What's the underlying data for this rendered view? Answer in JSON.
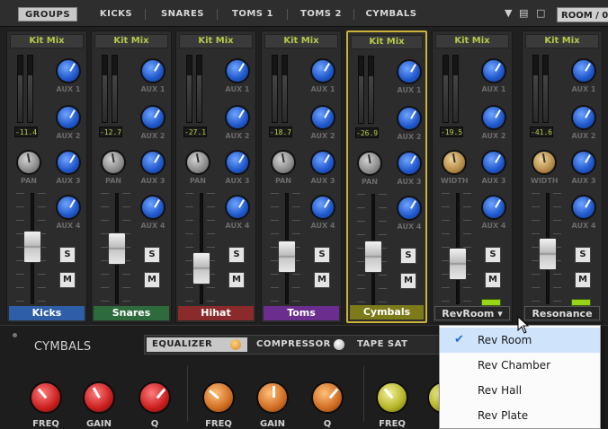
{
  "tabs": [
    {
      "label": "GROUPS",
      "active": true
    },
    {
      "label": "KICKS",
      "active": false
    },
    {
      "label": "SNARES",
      "active": false
    },
    {
      "label": "TOMS 1",
      "active": false
    },
    {
      "label": "TOMS 2",
      "active": false
    },
    {
      "label": "CYMBALS",
      "active": false
    }
  ],
  "toolbar": {
    "menu_icon": "dropdown-arrow-icon",
    "save_icon": "save-icon",
    "delete_icon": "trash-icon",
    "room_label": "ROOM / 0"
  },
  "channels": [
    {
      "kitmix": "Kit Mix",
      "peak": "-11.4",
      "aux": [
        "AUX 1",
        "AUX 2",
        "AUX 3",
        "AUX 4"
      ],
      "pan_label": "PAN",
      "name": "Kicks",
      "name_color": "#2f5ea8",
      "fader": 0.62,
      "solo": "S",
      "mute": "M"
    },
    {
      "kitmix": "Kit Mix",
      "peak": "-12.7",
      "aux": [
        "AUX 1",
        "AUX 2",
        "AUX 3",
        "AUX 4"
      ],
      "pan_label": "PAN",
      "name": "Snares",
      "name_color": "#2d6b3d",
      "fader": 0.6,
      "solo": "S",
      "mute": "M"
    },
    {
      "kitmix": "Kit Mix",
      "peak": "-27.1",
      "aux": [
        "AUX 1",
        "AUX 2",
        "AUX 3",
        "AUX 4"
      ],
      "pan_label": "PAN",
      "name": "Hihat",
      "name_color": "#8a2a2a",
      "fader": 0.4,
      "solo": "S",
      "mute": "M"
    },
    {
      "kitmix": "Kit Mix",
      "peak": "-18.7",
      "aux": [
        "AUX 1",
        "AUX 2",
        "AUX 3",
        "AUX 4"
      ],
      "pan_label": "PAN",
      "name": "Toms",
      "name_color": "#6b2d8e",
      "fader": 0.52,
      "solo": "S",
      "mute": "M"
    },
    {
      "kitmix": "Kit Mix",
      "peak": "-26.9",
      "aux": [
        "AUX 1",
        "AUX 2",
        "AUX 3",
        "AUX 4"
      ],
      "pan_label": "PAN",
      "name": "Cymbals",
      "name_color": "#7d7a1a",
      "fader": 0.53,
      "solo": "S",
      "mute": "M"
    },
    {
      "kitmix": "Kit Mix",
      "peak": "-19.5",
      "aux": [
        "AUX 1",
        "AUX 2",
        "AUX 3",
        "AUX 4"
      ],
      "pan_label": "WIDTH",
      "name": "RevRoom ▾",
      "name_color": "#262626",
      "fader": 0.45,
      "solo": "S",
      "mute": "M"
    },
    {
      "kitmix": "Kit Mix",
      "peak": "-41.6",
      "aux": [
        "AUX 1",
        "AUX 2",
        "AUX 3",
        "AUX 4"
      ],
      "pan_label": "WIDTH",
      "name": "Resonance",
      "name_color": "#262626",
      "fader": 0.55,
      "solo": "S",
      "mute": "M"
    }
  ],
  "lower": {
    "title": "CYMBALS",
    "fx_tabs": [
      "EQUALIZER",
      "COMPRESSOR",
      "TAPE SAT"
    ],
    "eq_labels": [
      "FREQ",
      "GAIN",
      "Q",
      "FREQ",
      "GAIN",
      "Q",
      "FREQ",
      "G"
    ]
  },
  "dropdown": {
    "items": [
      "Rev Room",
      "Rev Chamber",
      "Rev Hall",
      "Rev Plate"
    ],
    "selected": 0
  }
}
